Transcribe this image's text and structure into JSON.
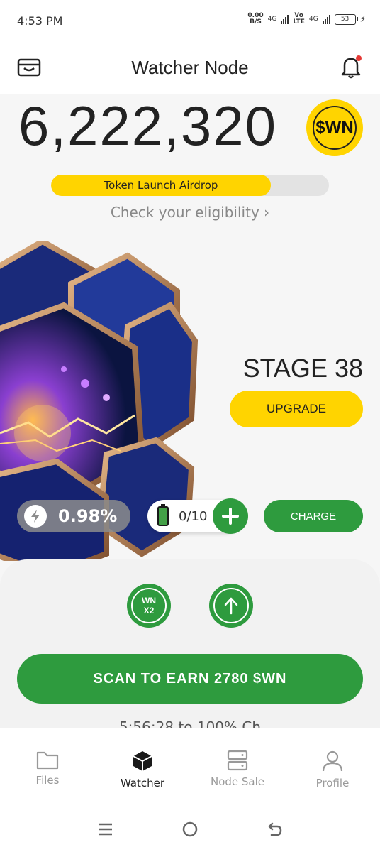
{
  "status_bar": {
    "time": "4:53 PM",
    "net_speed_value": "0.00",
    "net_speed_unit": "B/S",
    "signal_1_label": "4G",
    "volte_top": "Vo",
    "volte_bottom": "LTE",
    "signal_2_label": "4G",
    "battery_level": "53"
  },
  "header": {
    "title": "Watcher Node"
  },
  "balance": {
    "amount": "6,222,320",
    "token_symbol": "$WN"
  },
  "airdrop": {
    "progress_label": "Token Launch Airdrop",
    "progress_fraction": 0.79,
    "eligibility_link": "Check your eligibility ›"
  },
  "node": {
    "stage_label": "STAGE 38",
    "upgrade_label": "UPGRADE"
  },
  "stats": {
    "boost_percent": "0.98%",
    "battery_count": "0/10",
    "charge_label": "CHARGE"
  },
  "actions": {
    "multiplier_top": "WN",
    "multiplier_bottom": "X2",
    "scan_label": "SCAN TO EARN 2780 $WN",
    "scan_note": "5:56:28 to 100% Ch"
  },
  "bottom_nav": [
    {
      "label": "Files",
      "icon": "folder-icon"
    },
    {
      "label": "Watcher",
      "icon": "cube-icon"
    },
    {
      "label": "Node Sale",
      "icon": "server-icon"
    },
    {
      "label": "Profile",
      "icon": "person-icon"
    }
  ],
  "colors": {
    "accent_green": "#2e9b3e",
    "accent_yellow": "#ffd400",
    "notification_red": "#e53935"
  }
}
